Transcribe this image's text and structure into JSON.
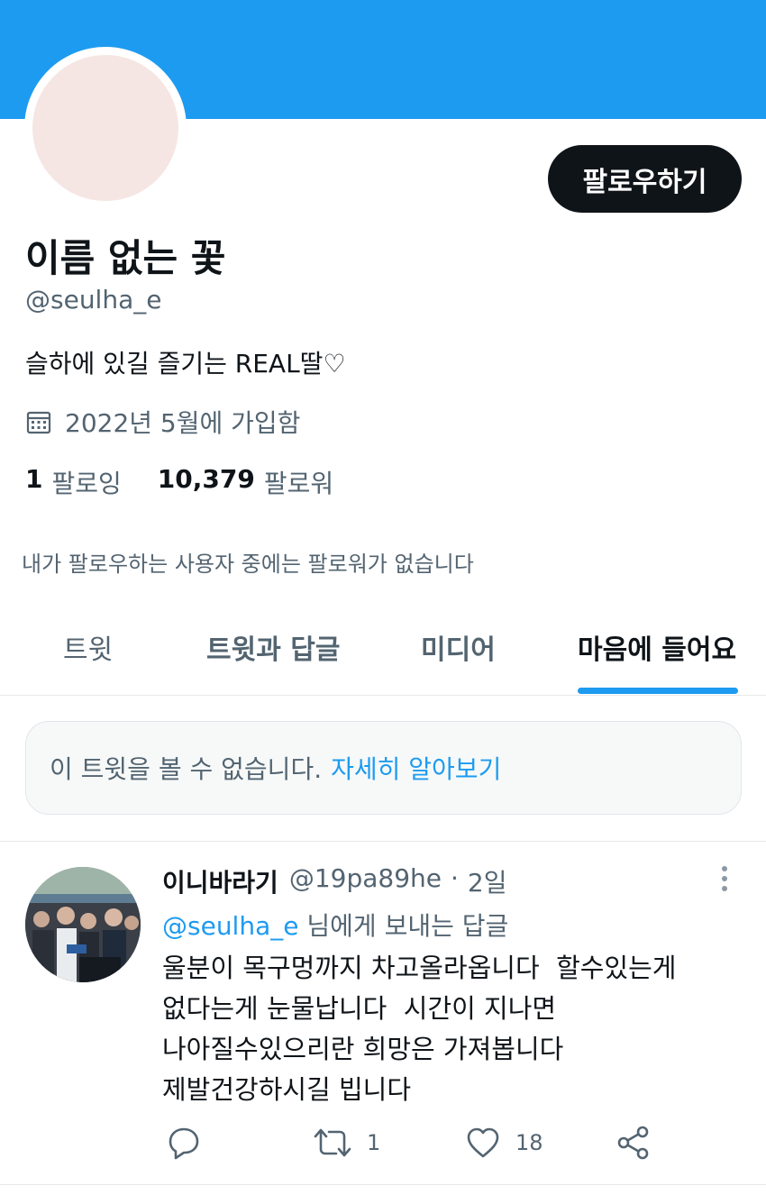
{
  "profile": {
    "display_name": "이름 없는 꽃",
    "handle": "@seulha_e",
    "bio": "슬하에 있길 즐기는 REAL딸♡",
    "joined": "2022년 5월에 가입함",
    "following_count": "1",
    "following_label": "팔로잉",
    "followers_count": "10,379",
    "followers_label": "팔로워",
    "mutual_note": "내가 팔로우하는 사용자 중에는 팔로워가 없습니다",
    "follow_button": "팔로우하기"
  },
  "tabs": [
    {
      "label": "트윗",
      "active": false
    },
    {
      "label": "트윗과 답글",
      "active": false
    },
    {
      "label": "미디어",
      "active": false
    },
    {
      "label": "마음에 들어요",
      "active": true
    }
  ],
  "unavailable": {
    "text": "이 트윗을 볼 수 없습니다.",
    "link": "자세히 알아보기"
  },
  "tweet": {
    "author_name": "이니바라기",
    "author_handle": "@19pa89he",
    "separator": "·",
    "time": "2일",
    "reply_mention": "@seulha_e",
    "reply_suffix": " 님에게 보내는 답글",
    "lines": [
      "울분이 목구멍까지 차고올라옵니다  할수있는게",
      "없다는게 눈물납니다  시간이 지나면",
      "나아질수있으리란 희망은 가져봅니다",
      "제발건강하시길 빕니다"
    ],
    "retweet_count": "1",
    "like_count": "18"
  },
  "icons": {
    "calendar": "calendar-icon",
    "more": "more-vertical-icon",
    "reply": "reply-icon",
    "retweet": "retweet-icon",
    "like": "heart-icon",
    "share": "share-icon"
  },
  "colors": {
    "accent": "#1d9bf0",
    "text": "#0f1419",
    "secondary": "#536471",
    "button": "#0f1419"
  }
}
